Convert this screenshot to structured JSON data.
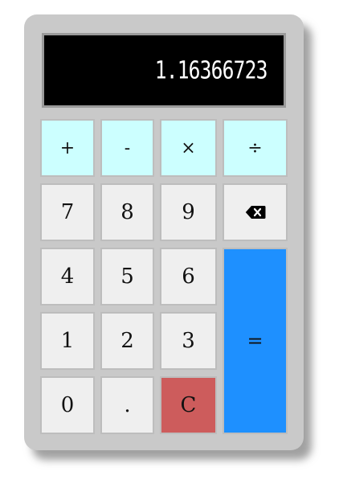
{
  "display": {
    "value": "1.16366723"
  },
  "operators": {
    "add": "+",
    "subtract": "-",
    "multiply": "×",
    "divide": "÷"
  },
  "digits": {
    "seven": "7",
    "eight": "8",
    "nine": "9",
    "four": "4",
    "five": "5",
    "six": "6",
    "one": "1",
    "two": "2",
    "three": "3",
    "zero": "0",
    "decimal": "."
  },
  "actions": {
    "clear": "C",
    "equals": "=",
    "backspace_icon": "backspace-icon"
  },
  "colors": {
    "operator_bg": "#ccffff",
    "number_bg": "#efefef",
    "clear_bg": "#cd5c5c",
    "equals_bg": "#1e90ff",
    "display_bg": "#000000",
    "display_text": "#ffffff",
    "body_bg": "#c9c9c9"
  }
}
